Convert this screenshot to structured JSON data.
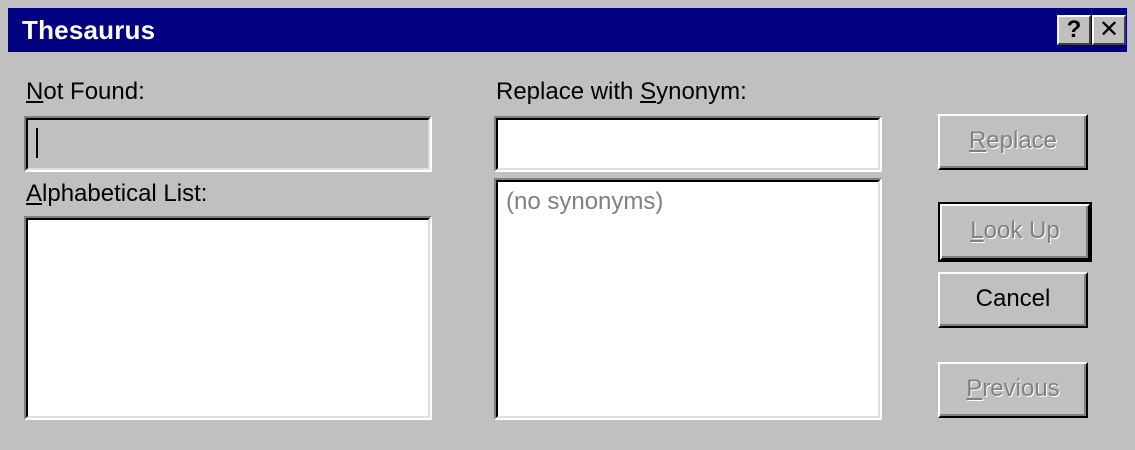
{
  "window": {
    "title": "Thesaurus",
    "help_glyph": "?",
    "close_glyph": "✕"
  },
  "left": {
    "not_found_label_mnemonic": "N",
    "not_found_label_rest": "ot Found:",
    "not_found_value": "",
    "alphabetical_label_mnemonic": "A",
    "alphabetical_label_rest": "lphabetical List:",
    "alphabetical_items": []
  },
  "right": {
    "replace_label_prefix": "Replace with ",
    "replace_label_mnemonic": "S",
    "replace_label_rest": "ynonym:",
    "replace_value": "",
    "synonym_list_placeholder": "(no synonyms)"
  },
  "buttons": {
    "replace_mnemonic": "R",
    "replace_rest": "eplace",
    "lookup_mnemonic": "L",
    "lookup_rest": "ook Up",
    "cancel": "Cancel",
    "previous_mnemonic": "P",
    "previous_rest": "revious"
  },
  "colors": {
    "title_bar": "#000080",
    "dialog_bg": "#c0c0c0",
    "disabled_text": "#808080"
  }
}
